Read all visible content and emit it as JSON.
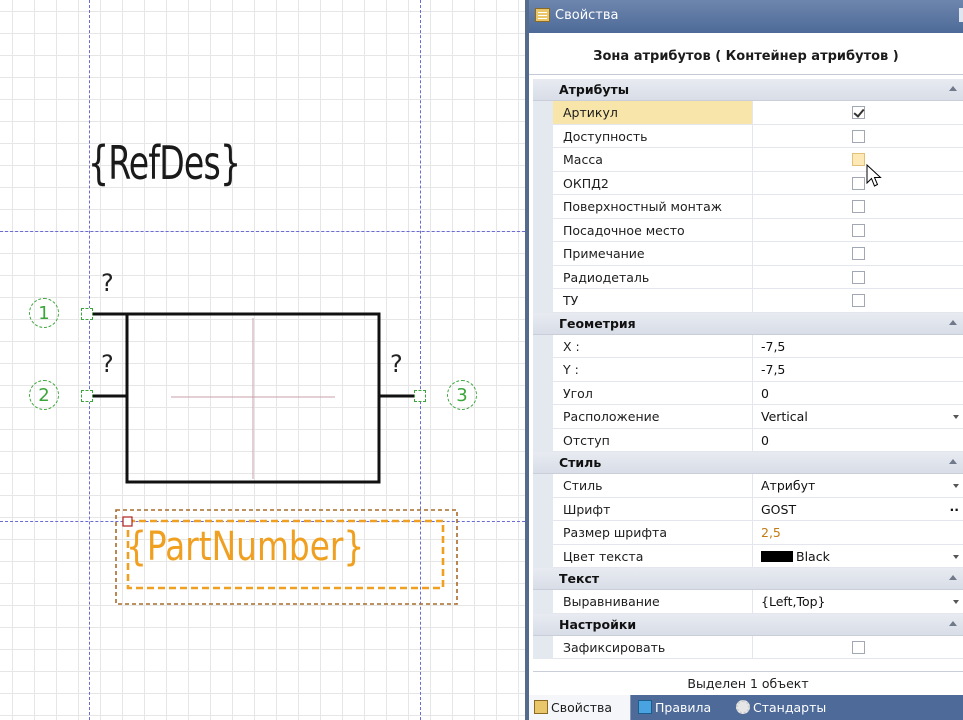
{
  "canvas": {
    "refdes_text": "{RefDes}",
    "partnumber_text": "{PartNumber}",
    "pin_question": "?",
    "pins": [
      {
        "number": "1"
      },
      {
        "number": "2"
      },
      {
        "number": "3"
      }
    ]
  },
  "panel": {
    "window_title": "Свойства",
    "header_title": "Зона атрибутов ( Контейнер атрибутов )",
    "sections": {
      "attributes": {
        "title": "Атрибуты",
        "rows": [
          {
            "name": "Артикул",
            "checked": true
          },
          {
            "name": "Доступность",
            "checked": false
          },
          {
            "name": "Масса",
            "checked": false
          },
          {
            "name": "ОКПД2",
            "checked": false
          },
          {
            "name": "Поверхностный монтаж",
            "checked": false
          },
          {
            "name": "Посадочное место",
            "checked": false
          },
          {
            "name": "Примечание",
            "checked": false
          },
          {
            "name": "Радиодеталь",
            "checked": false
          },
          {
            "name": "ТУ",
            "checked": false
          }
        ]
      },
      "geometry": {
        "title": "Геометрия",
        "rows": [
          {
            "name": "X :",
            "value": "-7,5"
          },
          {
            "name": "Y :",
            "value": "-7,5"
          },
          {
            "name": "Угол",
            "value": "0"
          },
          {
            "name": "Расположение",
            "value": "Vertical"
          },
          {
            "name": "Отступ",
            "value": "0"
          }
        ]
      },
      "style": {
        "title": "Стиль",
        "rows": [
          {
            "name": "Стиль",
            "value": "Атрибут"
          },
          {
            "name": "Шрифт",
            "value": "GOST"
          },
          {
            "name": "Размер шрифта",
            "value": "2,5"
          },
          {
            "name": "Цвет текста",
            "value": "Black",
            "color": "#000000"
          }
        ]
      },
      "text": {
        "title": "Текст",
        "rows": [
          {
            "name": "Выравнивание",
            "value": "{Left,Top}"
          }
        ]
      },
      "settings": {
        "title": "Настройки",
        "rows": [
          {
            "name": "Зафиксировать",
            "checked": false
          }
        ]
      }
    },
    "status": "Выделен 1 объект",
    "tabs": [
      {
        "label": "Свойства",
        "icon": "properties-icon"
      },
      {
        "label": "Правила",
        "icon": "rules-icon"
      },
      {
        "label": "Стандарты",
        "icon": "gear-icon"
      }
    ]
  }
}
